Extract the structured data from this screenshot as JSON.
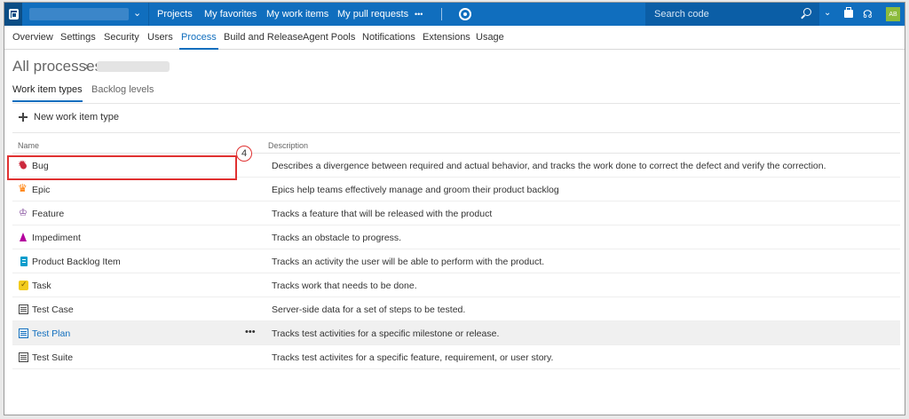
{
  "topbar": {
    "nav": [
      "Projects",
      "My favorites",
      "My work items",
      "My pull requests",
      "•••"
    ],
    "search_placeholder": "Search code",
    "avatar_initials": "AB",
    "accent": "#106ebe"
  },
  "settings_tabs": [
    "Overview",
    "Settings",
    "Security",
    "Users",
    "Process",
    "Build and Release",
    "Agent Pools",
    "Notifications",
    "Extensions",
    "Usage"
  ],
  "active_settings_tab": "Process",
  "header": {
    "breadcrumb_root": "All processes",
    "breadcrumb_sep": "›"
  },
  "subtabs": [
    "Work item types",
    "Backlog levels"
  ],
  "toolbar": {
    "new_label": "New work item type"
  },
  "table": {
    "col_name": "Name",
    "col_description": "Description",
    "rows": [
      {
        "name": "Bug",
        "icon": "bug-icon",
        "description": "Describes a divergence between required and actual behavior, and tracks the work done to correct the defect and verify the correction."
      },
      {
        "name": "Epic",
        "icon": "crown-icon",
        "description": "Epics help teams effectively manage and groom their product backlog"
      },
      {
        "name": "Feature",
        "icon": "trophy-icon",
        "description": "Tracks a feature that will be released with the product"
      },
      {
        "name": "Impediment",
        "icon": "impediment-icon",
        "description": "Tracks an obstacle to progress."
      },
      {
        "name": "Product Backlog Item",
        "icon": "backlog-item-icon",
        "description": "Tracks an activity the user will be able to perform with the product."
      },
      {
        "name": "Task",
        "icon": "task-icon",
        "description": "Tracks work that needs to be done."
      },
      {
        "name": "Test Case",
        "icon": "test-case-icon",
        "description": "Server-side data for a set of steps to be tested."
      },
      {
        "name": "Test Plan",
        "icon": "test-plan-icon",
        "description": "Tracks test activities for a specific milestone or release."
      },
      {
        "name": "Test Suite",
        "icon": "test-suite-icon",
        "description": "Tracks test activites for a specific feature, requirement, or user story."
      }
    ],
    "row_more": "•••"
  },
  "annotation": {
    "step_number": "4",
    "color": "#e03131"
  }
}
